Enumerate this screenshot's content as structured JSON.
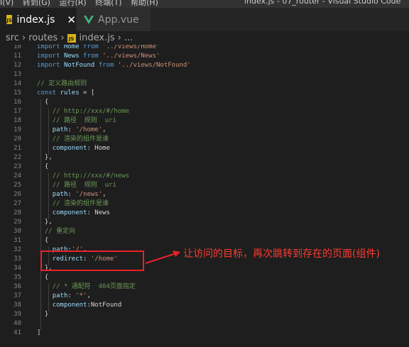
{
  "menu": [
    "I(V)",
    "转到(G)",
    "运行(R)",
    "终端(T)",
    "帮助(H)"
  ],
  "window_title": "index.js - 07_router - Visual Studio Code",
  "tabs": [
    {
      "label": "index.js",
      "icon": "js-file-icon",
      "active": true
    },
    {
      "label": "App.vue",
      "icon": "vue-file-icon",
      "active": false
    }
  ],
  "breadcrumb": [
    "src",
    "routes",
    "index.js",
    "..."
  ],
  "lines": [
    {
      "n": "10",
      "tokens": [
        [
          "kw",
          "import"
        ],
        [
          "plain",
          " "
        ],
        [
          "id",
          "Home"
        ],
        [
          "plain",
          " "
        ],
        [
          "kw",
          "from"
        ],
        [
          "plain",
          " "
        ],
        [
          "str",
          "'../views/Home'"
        ]
      ]
    },
    {
      "n": "11",
      "tokens": [
        [
          "kw",
          "import"
        ],
        [
          "plain",
          " "
        ],
        [
          "id",
          "News"
        ],
        [
          "plain",
          " "
        ],
        [
          "kw",
          "from"
        ],
        [
          "plain",
          " "
        ],
        [
          "str",
          "'../views/News'"
        ]
      ]
    },
    {
      "n": "12",
      "tokens": [
        [
          "kw",
          "import"
        ],
        [
          "plain",
          " "
        ],
        [
          "id",
          "NotFound"
        ],
        [
          "plain",
          " "
        ],
        [
          "kw",
          "from"
        ],
        [
          "plain",
          " "
        ],
        [
          "str",
          "'../views/NotFound'"
        ]
      ]
    },
    {
      "n": "13",
      "tokens": []
    },
    {
      "n": "14",
      "tokens": [
        [
          "cm",
          "// 定义路由规则"
        ]
      ]
    },
    {
      "n": "15",
      "tokens": [
        [
          "kw",
          "const"
        ],
        [
          "plain",
          " "
        ],
        [
          "id",
          "rules"
        ],
        [
          "plain",
          " = ["
        ]
      ]
    },
    {
      "n": "16",
      "tokens": [
        [
          "plain",
          "  {"
        ]
      ]
    },
    {
      "n": "17",
      "tokens": [
        [
          "plain",
          "    "
        ],
        [
          "cm",
          "// http://xxx/#/home"
        ]
      ]
    },
    {
      "n": "18",
      "tokens": [
        [
          "plain",
          "    "
        ],
        [
          "cm",
          "// 路径  规则  uri"
        ]
      ]
    },
    {
      "n": "19",
      "tokens": [
        [
          "plain",
          "    "
        ],
        [
          "id",
          "path"
        ],
        [
          "plain",
          ": "
        ],
        [
          "str",
          "'/home'"
        ],
        [
          "plain",
          ","
        ]
      ]
    },
    {
      "n": "20",
      "tokens": [
        [
          "plain",
          "    "
        ],
        [
          "cm",
          "// 渲染的组件是谁"
        ]
      ]
    },
    {
      "n": "21",
      "tokens": [
        [
          "plain",
          "    "
        ],
        [
          "id",
          "component"
        ],
        [
          "plain",
          ": Home"
        ]
      ]
    },
    {
      "n": "22",
      "tokens": [
        [
          "plain",
          "  },"
        ]
      ]
    },
    {
      "n": "23",
      "tokens": [
        [
          "plain",
          "  {"
        ]
      ]
    },
    {
      "n": "24",
      "tokens": [
        [
          "plain",
          "    "
        ],
        [
          "cm",
          "// http://xxx/#/news"
        ]
      ]
    },
    {
      "n": "25",
      "tokens": [
        [
          "plain",
          "    "
        ],
        [
          "cm",
          "// 路径  规则  uri"
        ]
      ]
    },
    {
      "n": "26",
      "tokens": [
        [
          "plain",
          "    "
        ],
        [
          "id",
          "path"
        ],
        [
          "plain",
          ": "
        ],
        [
          "str",
          "'/news'"
        ],
        [
          "plain",
          ","
        ]
      ]
    },
    {
      "n": "27",
      "tokens": [
        [
          "plain",
          "    "
        ],
        [
          "cm",
          "// 渲染的组件是谁"
        ]
      ]
    },
    {
      "n": "28",
      "tokens": [
        [
          "plain",
          "    "
        ],
        [
          "id",
          "component"
        ],
        [
          "plain",
          ": News"
        ]
      ]
    },
    {
      "n": "29",
      "tokens": [
        [
          "plain",
          "  },"
        ]
      ]
    },
    {
      "n": "30",
      "tokens": [
        [
          "plain",
          "  "
        ],
        [
          "cm",
          "// 重定向"
        ]
      ]
    },
    {
      "n": "31",
      "tokens": [
        [
          "plain",
          "  {"
        ]
      ]
    },
    {
      "n": "32",
      "tokens": [
        [
          "plain",
          "    "
        ],
        [
          "id",
          "path"
        ],
        [
          "plain",
          ":"
        ],
        [
          "str",
          "'/'"
        ],
        [
          "plain",
          ","
        ]
      ]
    },
    {
      "n": "33",
      "tokens": [
        [
          "plain",
          "    "
        ],
        [
          "id",
          "redirect"
        ],
        [
          "plain",
          ": "
        ],
        [
          "str",
          "'/home'"
        ]
      ]
    },
    {
      "n": "34",
      "tokens": [
        [
          "plain",
          "  },"
        ]
      ]
    },
    {
      "n": "35",
      "tokens": [
        [
          "plain",
          "  {"
        ]
      ]
    },
    {
      "n": "36",
      "tokens": [
        [
          "plain",
          "    "
        ],
        [
          "cm",
          "// * 通配符  404页面指定"
        ]
      ]
    },
    {
      "n": "37",
      "tokens": [
        [
          "plain",
          "    "
        ],
        [
          "id",
          "path"
        ],
        [
          "plain",
          ": "
        ],
        [
          "str",
          "'*'"
        ],
        [
          "plain",
          ","
        ]
      ]
    },
    {
      "n": "38",
      "tokens": [
        [
          "plain",
          "    "
        ],
        [
          "id",
          "component"
        ],
        [
          "plain",
          ":NotFound"
        ]
      ]
    },
    {
      "n": "39",
      "tokens": [
        [
          "plain",
          "  }"
        ]
      ]
    },
    {
      "n": "40",
      "tokens": []
    },
    {
      "n": "41",
      "tokens": [
        [
          "plain",
          "]"
        ]
      ]
    }
  ],
  "annotation": "让访问的目标，再次跳转到存在的页面(组件)",
  "colors": {
    "annotation_red": "#e8222a",
    "keyword": "#569cd6",
    "string": "#ce9178",
    "comment": "#6a9955",
    "variable": "#9cdcfe"
  }
}
